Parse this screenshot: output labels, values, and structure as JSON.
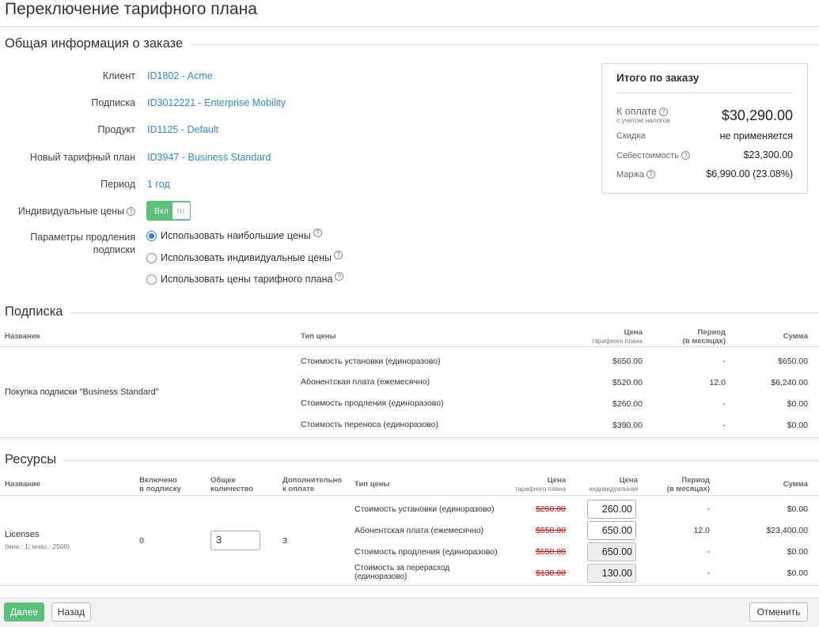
{
  "page": {
    "title": "Переключение тарифного плана"
  },
  "general": {
    "heading": "Общая информация о заказе",
    "fields": [
      {
        "label": "Клиент",
        "value": "ID1802 - Acme"
      },
      {
        "label": "Подписка",
        "value": "ID3012221 - Enterprise Mobility"
      },
      {
        "label": "Продукт",
        "value": "ID1125 - Default"
      },
      {
        "label": "Новый тарифный план",
        "value": "ID3947 - Business Standard"
      },
      {
        "label": "Период",
        "value": "1 год"
      }
    ],
    "individual_prices_label": "Индивидуальные цены",
    "toggle_label": "Вкл",
    "toggle_on": true,
    "renewal_label_1": "Параметры продления",
    "renewal_label_2": "подписки",
    "renewal_options": [
      {
        "label": "Использовать наибольшие цены",
        "checked": true
      },
      {
        "label": "Использовать индивидуальные цены",
        "checked": false
      },
      {
        "label": "Использовать цены тарифного плана",
        "checked": false
      }
    ]
  },
  "summary": {
    "title": "Итого по заказу",
    "to_pay_label": "К оплате",
    "to_pay_sub": "с учетом налогов",
    "to_pay_value": "$30,290.00",
    "discount_label": "Скидка",
    "discount_value": "не применяется",
    "cost_label": "Себестоимость",
    "cost_value": "$23,300.00",
    "margin_label": "Маржа",
    "margin_value": "$6,990.00 (23.08%)"
  },
  "subscription": {
    "heading": "Подписка",
    "columns": {
      "name": "Название",
      "price_type": "Тип цены",
      "plan_price": "Цена",
      "plan_price_sub": "тарифного плана",
      "period": "Период",
      "period_sub": "(в месяцах)",
      "sum": "Сумма"
    },
    "item_name": "Покупка подписки \"Business Standard\"",
    "rows": [
      {
        "type": "Стоимость установки (единоразово)",
        "price": "$650.00",
        "period": "-",
        "sum": "$650.00"
      },
      {
        "type": "Абонентская плата (ежемесячно)",
        "price": "$520.00",
        "period": "12.0",
        "sum": "$6,240.00"
      },
      {
        "type": "Стоимость продления (единоразово)",
        "price": "$260.00",
        "period": "-",
        "sum": "$0.00"
      },
      {
        "type": "Стоимость переноса (единоразово)",
        "price": "$390.00",
        "period": "-",
        "sum": "$0.00"
      }
    ]
  },
  "resources": {
    "heading": "Ресурсы",
    "columns": {
      "name": "Название",
      "included_1": "Включено",
      "included_2": "в подписку",
      "total_1": "Общее",
      "total_2": "количество",
      "additional_1": "Дополнительно",
      "additional_2": "к оплате",
      "price_type": "Тип цены",
      "plan_price": "Цена",
      "plan_price_sub": "тарифного плана",
      "indiv_price": "Цена",
      "indiv_price_sub": "индивидуальная",
      "period": "Период",
      "period_sub": "(в месяцах)",
      "sum": "Сумма"
    },
    "item_name": "Licenses",
    "item_limits": "(мин.: 1; макс.: 2500)",
    "included": "0",
    "quantity": "3",
    "additional": "3",
    "rows": [
      {
        "type": "Стоимость установки (единоразово)",
        "plan_price": "$260.00",
        "indiv_price": "260.00",
        "editable": true,
        "period": "-",
        "sum": "$0.00"
      },
      {
        "type": "Абонентская плата (ежемесячно)",
        "plan_price": "$650.00",
        "indiv_price": "650.00",
        "editable": true,
        "period": "12.0",
        "sum": "$23,400.00"
      },
      {
        "type": "Стоимость продления (единоразово)",
        "plan_price": "$650.00",
        "indiv_price": "650.00",
        "editable": false,
        "period": "-",
        "sum": "$0.00"
      },
      {
        "type_1": "Стоимость за перерасход",
        "type_2": "(единоразово)",
        "plan_price": "$130.00",
        "indiv_price": "130.00",
        "editable": false,
        "period": "-",
        "sum": "$0.00"
      }
    ]
  },
  "footer": {
    "next": "Далее",
    "back": "Назад",
    "cancel": "Отменить"
  },
  "colors": {
    "primary": "#5cbf7a",
    "link": "#2f8ad0",
    "strike": "#cc0000"
  },
  "icons": {
    "help": "help-circle-icon"
  }
}
